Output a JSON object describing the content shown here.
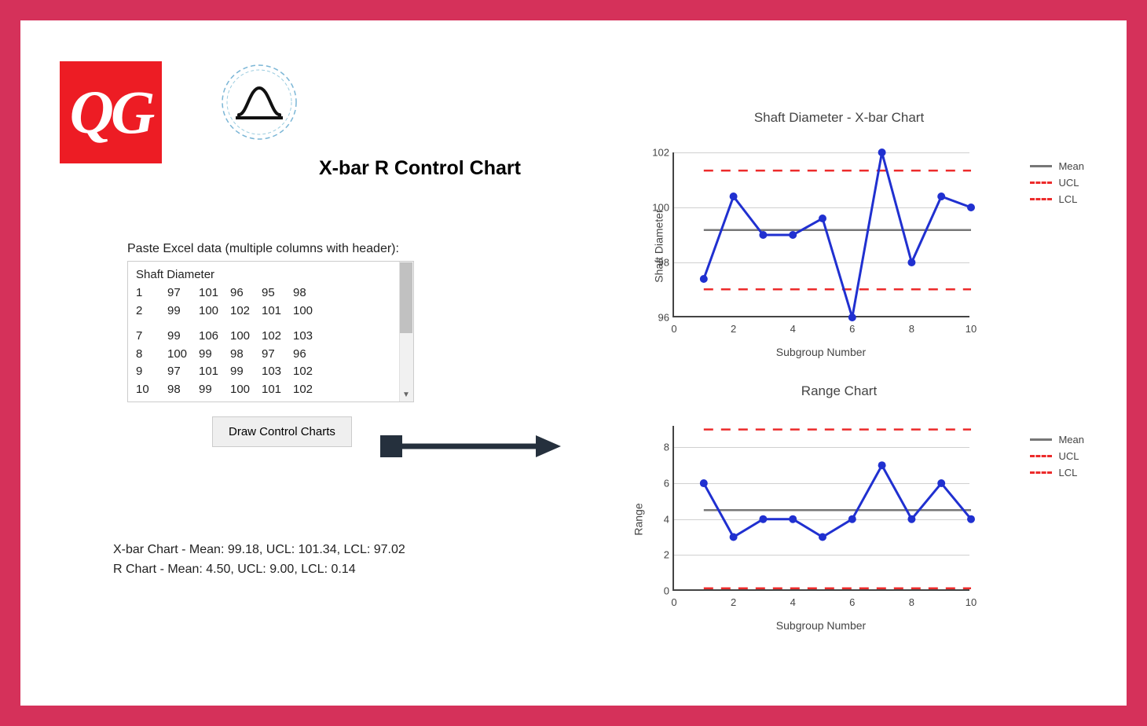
{
  "branding": {
    "qg": "QG"
  },
  "page": {
    "title": "X-bar R Control Chart"
  },
  "input": {
    "label": "Paste Excel data (multiple columns with header):",
    "header": "Shaft Diameter",
    "rows": [
      {
        "n": "1",
        "v": [
          "97",
          "101",
          "96",
          "95",
          "98"
        ]
      },
      {
        "n": "2",
        "v": [
          "99",
          "100",
          "102",
          "101",
          "100"
        ]
      },
      {
        "n": "7",
        "v": [
          "99",
          "106",
          "100",
          "102",
          "103"
        ]
      },
      {
        "n": "8",
        "v": [
          "100",
          "99",
          "98",
          "97",
          "96"
        ]
      },
      {
        "n": "9",
        "v": [
          "97",
          "101",
          "99",
          "103",
          "102"
        ]
      },
      {
        "n": "10",
        "v": [
          "98",
          "99",
          "100",
          "101",
          "102"
        ]
      }
    ],
    "button": "Draw Control Charts"
  },
  "stats": {
    "line1": "X-bar Chart - Mean: 99.18, UCL: 101.34, LCL: 97.02",
    "line2": "R Chart - Mean: 4.50, UCL: 9.00, LCL: 0.14"
  },
  "legend": {
    "mean": "Mean",
    "ucl": "UCL",
    "lcl": "LCL"
  },
  "chart_data": [
    {
      "type": "line",
      "title": "Shaft Diameter - X-bar Chart",
      "xlabel": "Subgroup Number",
      "ylabel": "Shaft Diameter",
      "x": [
        1,
        2,
        3,
        4,
        5,
        6,
        7,
        8,
        9,
        10
      ],
      "values": [
        97.4,
        100.4,
        99.0,
        99.0,
        99.6,
        96.0,
        102.0,
        98.0,
        100.4,
        100.0
      ],
      "mean": 99.18,
      "ucl": 101.34,
      "lcl": 97.02,
      "xlim": [
        0,
        10
      ],
      "ylim": [
        96,
        102
      ],
      "yticks": [
        96,
        98,
        100,
        102
      ],
      "xticks": [
        0,
        2,
        4,
        6,
        8,
        10
      ],
      "legend": [
        "Mean",
        "UCL",
        "LCL"
      ]
    },
    {
      "type": "line",
      "title": "Range Chart",
      "xlabel": "Subgroup Number",
      "ylabel": "Range",
      "x": [
        1,
        2,
        3,
        4,
        5,
        6,
        7,
        8,
        9,
        10
      ],
      "values": [
        6,
        3,
        4,
        4,
        3,
        4,
        7,
        4,
        6,
        4
      ],
      "mean": 4.5,
      "ucl": 9.0,
      "lcl": 0.14,
      "xlim": [
        0,
        10
      ],
      "ylim": [
        0,
        9.2
      ],
      "yticks": [
        0,
        2,
        4,
        6,
        8
      ],
      "xticks": [
        0,
        2,
        4,
        6,
        8,
        10
      ],
      "legend": [
        "Mean",
        "UCL",
        "LCL"
      ]
    }
  ]
}
